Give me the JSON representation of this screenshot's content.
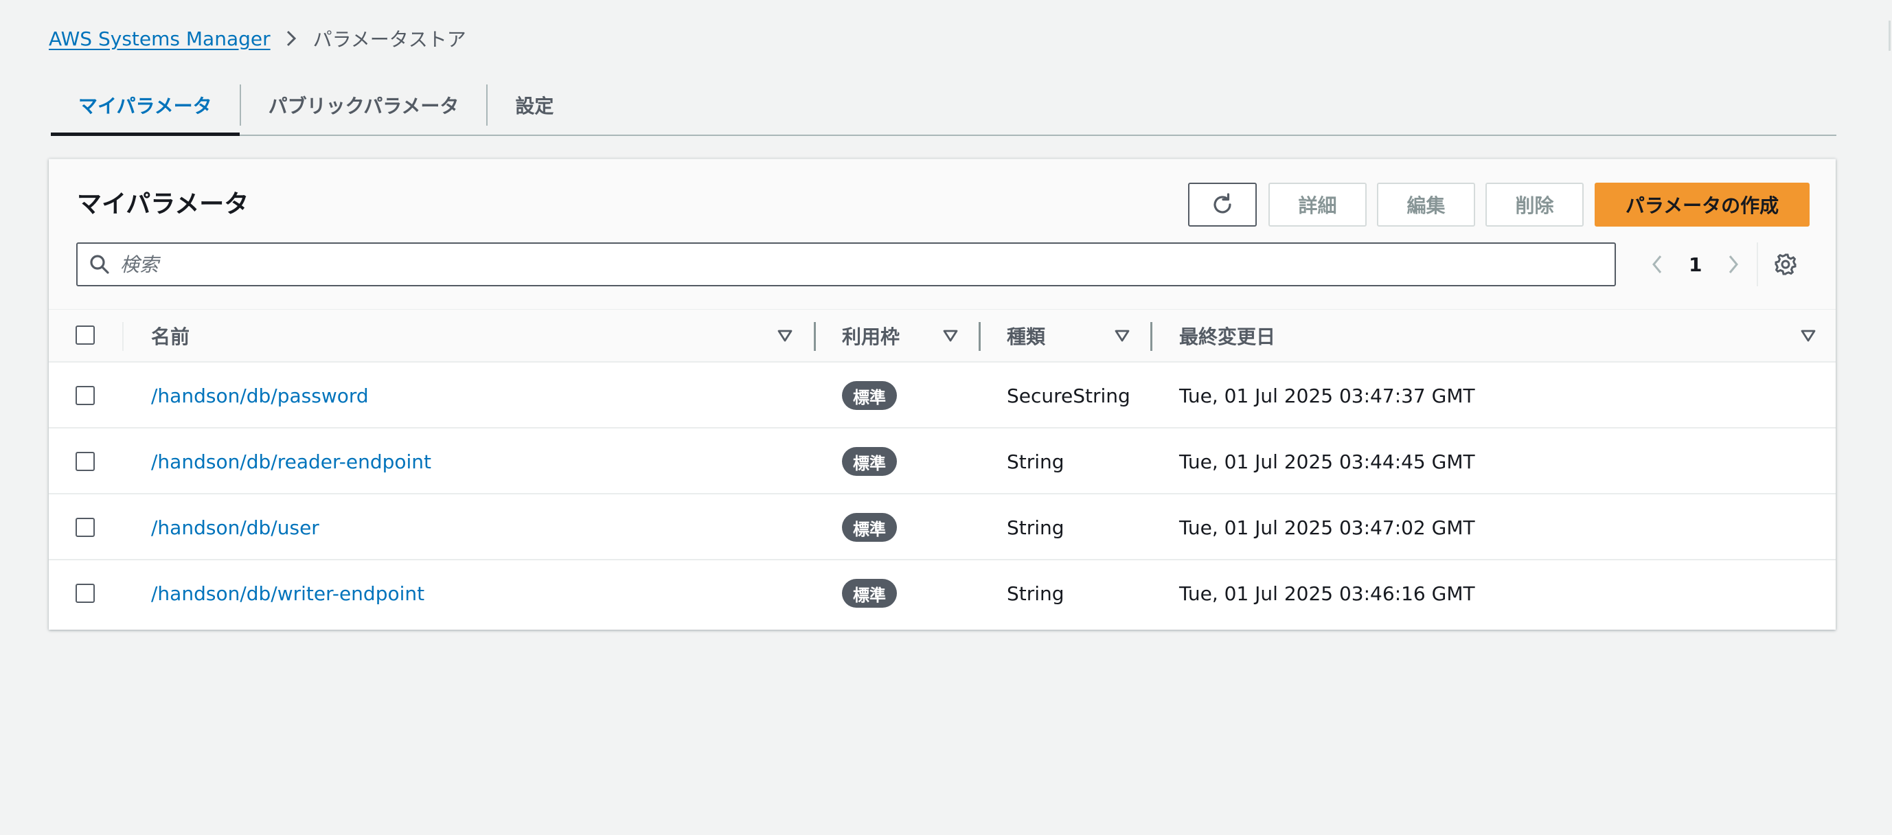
{
  "breadcrumb": {
    "service": "AWS Systems Manager",
    "current": "パラメータストア"
  },
  "tabs": [
    {
      "label": "マイパラメータ",
      "active": true
    },
    {
      "label": "パブリックパラメータ",
      "active": false
    },
    {
      "label": "設定",
      "active": false
    }
  ],
  "panel": {
    "title": "マイパラメータ",
    "buttons": {
      "details": "詳細",
      "edit": "編集",
      "delete": "削除",
      "create": "パラメータの作成"
    },
    "search_placeholder": "検索",
    "page": "1"
  },
  "table": {
    "columns": [
      "名前",
      "利用枠",
      "種類",
      "最終変更日"
    ],
    "rows": [
      {
        "name": "/handson/db/password",
        "tier": "標準",
        "type": "SecureString",
        "modified": "Tue, 01 Jul 2025 03:47:37 GMT"
      },
      {
        "name": "/handson/db/reader-endpoint",
        "tier": "標準",
        "type": "String",
        "modified": "Tue, 01 Jul 2025 03:44:45 GMT"
      },
      {
        "name": "/handson/db/user",
        "tier": "標準",
        "type": "String",
        "modified": "Tue, 01 Jul 2025 03:47:02 GMT"
      },
      {
        "name": "/handson/db/writer-endpoint",
        "tier": "標準",
        "type": "String",
        "modified": "Tue, 01 Jul 2025 03:46:16 GMT"
      }
    ]
  },
  "colors": {
    "link": "#0073bb",
    "primary_button": "#f2972f",
    "badge": "#545b64",
    "background": "#f2f3f3"
  },
  "icons": {
    "refresh": "refresh-icon",
    "search": "search-icon",
    "prev": "chevron-left-icon",
    "next": "chevron-right-icon",
    "settings": "gear-icon",
    "sort": "sort-down-icon",
    "breadcrumb_separator": "chevron-right-icon"
  }
}
